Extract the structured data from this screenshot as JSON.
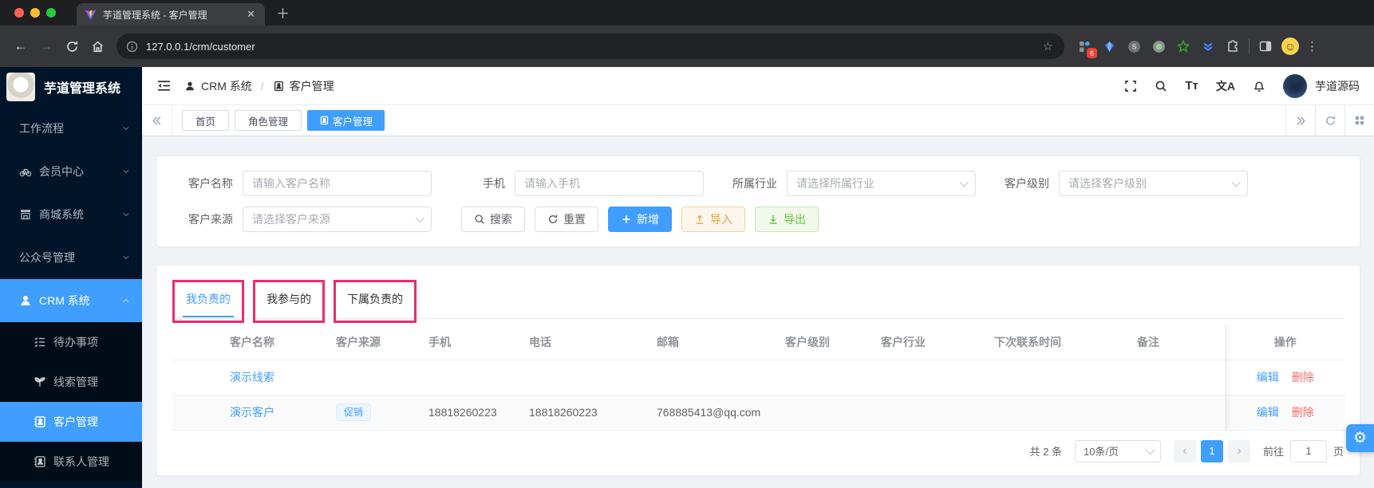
{
  "browser": {
    "tab_title": "芋道管理系统 - 客户管理",
    "url": "127.0.0.1/crm/customer",
    "extension_badge": "6"
  },
  "sidebar": {
    "logo_text": "芋道管理系统",
    "items": [
      {
        "label": "工作流程"
      },
      {
        "label": "会员中心"
      },
      {
        "label": "商城系统"
      },
      {
        "label": "公众号管理"
      },
      {
        "label": "CRM 系统"
      }
    ],
    "sub_items": [
      {
        "label": "待办事项"
      },
      {
        "label": "线索管理"
      },
      {
        "label": "客户管理"
      },
      {
        "label": "联系人管理"
      }
    ]
  },
  "header": {
    "breadcrumb1": "CRM 系统",
    "breadcrumb_sep": "/",
    "breadcrumb2": "客户管理",
    "font_icon": "Tт",
    "lang_icon": "文A",
    "username": "芋道源码"
  },
  "tagbar": {
    "tabs": [
      {
        "label": "首页"
      },
      {
        "label": "角色管理"
      },
      {
        "label": "客户管理"
      }
    ]
  },
  "filters": {
    "name_label": "客户名称",
    "name_placeholder": "请输入客户名称",
    "mobile_label": "手机",
    "mobile_placeholder": "请输入手机",
    "industry_label": "所属行业",
    "industry_placeholder": "请选择所属行业",
    "level_label": "客户级别",
    "level_placeholder": "请选择客户级别",
    "source_label": "客户来源",
    "source_placeholder": "请选择客户来源",
    "search": "搜索",
    "reset": "重置",
    "add": "新增",
    "import": "导入",
    "export": "导出"
  },
  "tabs": [
    {
      "label": "我负责的"
    },
    {
      "label": "我参与的"
    },
    {
      "label": "下属负责的"
    }
  ],
  "table": {
    "columns": [
      "客户名称",
      "客户来源",
      "手机",
      "电话",
      "邮箱",
      "客户级别",
      "客户行业",
      "下次联系时间",
      "备注",
      "操作"
    ],
    "rows": [
      {
        "name": "演示线索",
        "source_tag": "",
        "mobile": "",
        "phone": "",
        "email": "",
        "level": "",
        "industry": "",
        "next_time": "",
        "remark": ""
      },
      {
        "name": "演示客户",
        "source_tag": "促销",
        "mobile": "18818260223",
        "phone": "18818260223",
        "email": "768885413@qq.com",
        "level": "",
        "industry": "",
        "next_time": "",
        "remark": ""
      }
    ],
    "edit": "编辑",
    "delete": "删除"
  },
  "pagination": {
    "total": "共 2 条",
    "page_size": "10条/页",
    "page": "1",
    "goto": "前往",
    "goto_value": "1",
    "unit": "页"
  },
  "colors": {
    "accent": "#409eff",
    "annotation": "#ee2b6b",
    "danger": "#f56c6c"
  }
}
